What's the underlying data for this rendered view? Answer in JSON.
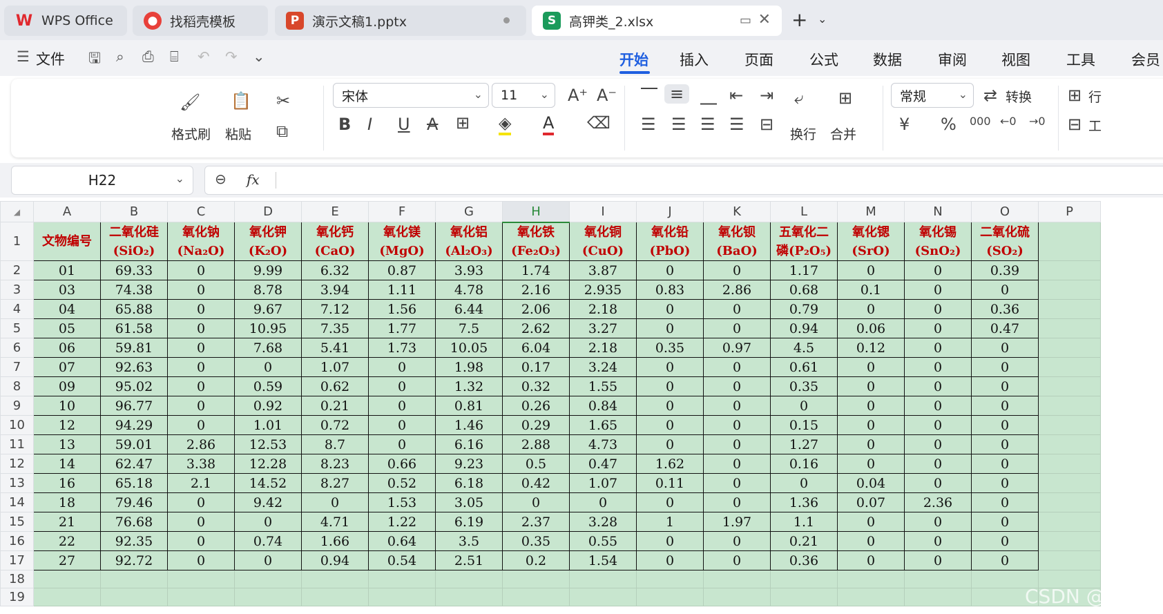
{
  "tabs": [
    {
      "label": "WPS Office",
      "icon": "wps-logo"
    },
    {
      "label": "找稻壳模板",
      "icon": "docer-logo"
    },
    {
      "label": "演示文稿1.pptx",
      "icon": "presentation-logo"
    },
    {
      "label": "高钾类_2.xlsx",
      "icon": "spreadsheet-logo"
    }
  ],
  "menu": {
    "file_label": "文件",
    "items": [
      "开始",
      "插入",
      "页面",
      "公式",
      "数据",
      "审阅",
      "视图",
      "工具",
      "会员"
    ]
  },
  "ribbon": {
    "format_painter": "格式刷",
    "paste": "粘贴",
    "font_name": "宋体",
    "font_size": "11",
    "wrap": "换行",
    "merge": "合并",
    "number_format": "常规",
    "convert": "转换",
    "row_col": "行",
    "worksheet": "工"
  },
  "formula_bar": {
    "cell_ref": "H22",
    "fx": "fx",
    "content": ""
  },
  "sheet": {
    "columns": [
      "A",
      "B",
      "C",
      "D",
      "E",
      "F",
      "G",
      "H",
      "I",
      "J",
      "K",
      "L",
      "M",
      "N",
      "O",
      "P"
    ],
    "selected_column": "H",
    "header_row": [
      [
        "文物编号",
        ""
      ],
      [
        "二氧化硅",
        "(SiO₂)"
      ],
      [
        "氧化钠",
        "(Na₂O)"
      ],
      [
        "氧化钾",
        "(K₂O)"
      ],
      [
        "氧化钙",
        "(CaO)"
      ],
      [
        "氧化镁",
        "(MgO)"
      ],
      [
        "氧化铝",
        "(Al₂O₃)"
      ],
      [
        "氧化铁",
        "(Fe₂O₃)"
      ],
      [
        "氧化铜",
        "(CuO)"
      ],
      [
        "氧化铅",
        "(PbO)"
      ],
      [
        "氧化钡",
        "(BaO)"
      ],
      [
        "五氧化二",
        "磷(P₂O₅)"
      ],
      [
        "氧化锶",
        "(SrO)"
      ],
      [
        "氧化锡",
        "(SnO₂)"
      ],
      [
        "二氧化硫",
        "(SO₂)"
      ]
    ],
    "rows": [
      [
        "01",
        "69.33",
        "0",
        "9.99",
        "6.32",
        "0.87",
        "3.93",
        "1.74",
        "3.87",
        "0",
        "0",
        "1.17",
        "0",
        "0",
        "0.39"
      ],
      [
        "03",
        "74.38",
        "0",
        "8.78",
        "3.94",
        "1.11",
        "4.78",
        "2.16",
        "2.935",
        "0.83",
        "2.86",
        "0.68",
        "0.1",
        "0",
        "0"
      ],
      [
        "04",
        "65.88",
        "0",
        "9.67",
        "7.12",
        "1.56",
        "6.44",
        "2.06",
        "2.18",
        "0",
        "0",
        "0.79",
        "0",
        "0",
        "0.36"
      ],
      [
        "05",
        "61.58",
        "0",
        "10.95",
        "7.35",
        "1.77",
        "7.5",
        "2.62",
        "3.27",
        "0",
        "0",
        "0.94",
        "0.06",
        "0",
        "0.47"
      ],
      [
        "06",
        "59.81",
        "0",
        "7.68",
        "5.41",
        "1.73",
        "10.05",
        "6.04",
        "2.18",
        "0.35",
        "0.97",
        "4.5",
        "0.12",
        "0",
        "0"
      ],
      [
        "07",
        "92.63",
        "0",
        "0",
        "1.07",
        "0",
        "1.98",
        "0.17",
        "3.24",
        "0",
        "0",
        "0.61",
        "0",
        "0",
        "0"
      ],
      [
        "09",
        "95.02",
        "0",
        "0.59",
        "0.62",
        "0",
        "1.32",
        "0.32",
        "1.55",
        "0",
        "0",
        "0.35",
        "0",
        "0",
        "0"
      ],
      [
        "10",
        "96.77",
        "0",
        "0.92",
        "0.21",
        "0",
        "0.81",
        "0.26",
        "0.84",
        "0",
        "0",
        "0",
        "0",
        "0",
        "0"
      ],
      [
        "12",
        "94.29",
        "0",
        "1.01",
        "0.72",
        "0",
        "1.46",
        "0.29",
        "1.65",
        "0",
        "0",
        "0.15",
        "0",
        "0",
        "0"
      ],
      [
        "13",
        "59.01",
        "2.86",
        "12.53",
        "8.7",
        "0",
        "6.16",
        "2.88",
        "4.73",
        "0",
        "0",
        "1.27",
        "0",
        "0",
        "0"
      ],
      [
        "14",
        "62.47",
        "3.38",
        "12.28",
        "8.23",
        "0.66",
        "9.23",
        "0.5",
        "0.47",
        "1.62",
        "0",
        "0.16",
        "0",
        "0",
        "0"
      ],
      [
        "16",
        "65.18",
        "2.1",
        "14.52",
        "8.27",
        "0.52",
        "6.18",
        "0.42",
        "1.07",
        "0.11",
        "0",
        "0",
        "0.04",
        "0",
        "0"
      ],
      [
        "18",
        "79.46",
        "0",
        "9.42",
        "0",
        "1.53",
        "3.05",
        "0",
        "0",
        "0",
        "0",
        "1.36",
        "0.07",
        "2.36",
        "0"
      ],
      [
        "21",
        "76.68",
        "0",
        "0",
        "4.71",
        "1.22",
        "6.19",
        "2.37",
        "3.28",
        "1",
        "1.97",
        "1.1",
        "0",
        "0",
        "0"
      ],
      [
        "22",
        "92.35",
        "0",
        "0.74",
        "1.66",
        "0.64",
        "3.5",
        "0.35",
        "0.55",
        "0",
        "0",
        "0.21",
        "0",
        "0",
        "0"
      ],
      [
        "27",
        "92.72",
        "0",
        "0",
        "0.94",
        "0.54",
        "2.51",
        "0.2",
        "1.54",
        "0",
        "0",
        "0.36",
        "0",
        "0",
        "0"
      ]
    ],
    "row_numbers": [
      "1",
      "2",
      "3",
      "4",
      "5",
      "6",
      "7",
      "8",
      "9",
      "10",
      "11",
      "12",
      "13",
      "14",
      "15",
      "16",
      "17",
      "18",
      "19"
    ]
  },
  "watermark": "CSDN @Sily",
  "colors": {
    "header_text": "#c00000",
    "cell_fill": "#c8e6cf",
    "accent": "#1f5fe0"
  }
}
